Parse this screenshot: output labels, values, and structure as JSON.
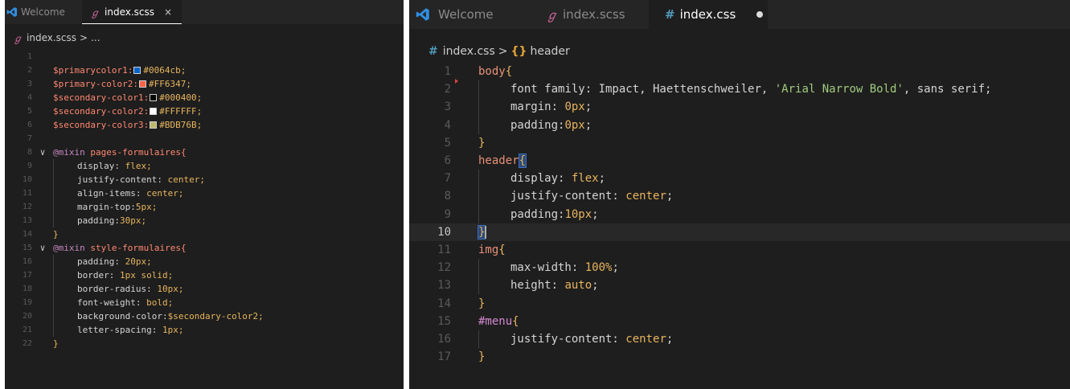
{
  "left_editor": {
    "tabs": [
      {
        "label": "Welcome",
        "icon": "vscode-logo-icon",
        "active": false
      },
      {
        "label": "index.scss",
        "icon": "sass-file-icon",
        "active": true,
        "action": "×"
      }
    ],
    "breadcrumb": {
      "file": "index.scss",
      "sep": ">",
      "rest": "..."
    },
    "lines": [
      {
        "n": "1"
      },
      {
        "n": "2",
        "var": "$primarycolor1:",
        "swatch": "#0064cb",
        "val": "#0064cb;"
      },
      {
        "n": "3",
        "var": "$primary-color2:",
        "swatch": "#FF6347",
        "val": "#FF6347;"
      },
      {
        "n": "4",
        "var": "$secondary-color1:",
        "swatch": "#000400",
        "val": "#000400;"
      },
      {
        "n": "5",
        "var": "$secondary-color2:",
        "swatch": "#FFFFFF",
        "val": "#FFFFFF;"
      },
      {
        "n": "6",
        "var": "$secondary-color3:",
        "swatch": "#BDB76B",
        "val": "#BDB76B;"
      },
      {
        "n": "7"
      },
      {
        "n": "8",
        "fold": "∨",
        "at": "@mixin",
        "name": " pages-formulaires{"
      },
      {
        "n": "9",
        "prop": "display: ",
        "val": "flex;"
      },
      {
        "n": "10",
        "prop": "justify-content: ",
        "val": "center;"
      },
      {
        "n": "11",
        "prop": "align-items: ",
        "val": "center;"
      },
      {
        "n": "12",
        "prop": "margin-top:",
        "val": "5px;"
      },
      {
        "n": "13",
        "prop": "padding:",
        "val": "30px;"
      },
      {
        "n": "14",
        "close": "}"
      },
      {
        "n": "15",
        "fold": "∨",
        "at": "@mixin",
        "name": " style-formulaires{"
      },
      {
        "n": "16",
        "prop": "padding: ",
        "val": "20px;"
      },
      {
        "n": "17",
        "prop": "border: ",
        "val": "1px solid;"
      },
      {
        "n": "18",
        "prop": "border-radius: ",
        "val": "10px;"
      },
      {
        "n": "19",
        "prop": "font-weight: ",
        "val": "bold;"
      },
      {
        "n": "20",
        "prop": "background-color:",
        "val": "$secondary-color2;"
      },
      {
        "n": "21",
        "prop": "letter-spacing: ",
        "val": "1px;"
      },
      {
        "n": "22",
        "close": "}"
      }
    ]
  },
  "right_editor": {
    "tabs": [
      {
        "label": "Welcome",
        "icon": "vscode-logo-icon",
        "active": false
      },
      {
        "label": "index.scss",
        "icon": "sass-file-icon",
        "active": false
      },
      {
        "label": "index.css",
        "icon": "css-file-icon",
        "active": true
      }
    ],
    "breadcrumb": {
      "file": "index.css",
      "sep": ">",
      "symbol": "header"
    },
    "lines": {
      "l1": {
        "n": "1",
        "sel": "body",
        "punc": "{"
      },
      "l2": {
        "n": "2",
        "prop": "font family: ",
        "str1": "Impact, Haettenschweiler, ",
        "str2": "'Arial Narrow Bold'",
        "str3": ", sans serif;"
      },
      "l3": {
        "n": "3",
        "prop": "margin: ",
        "val": "0px",
        "end": ";"
      },
      "l4": {
        "n": "4",
        "prop": "padding:",
        "val": "0px",
        "end": ";"
      },
      "l5": {
        "n": "5",
        "close": "}"
      },
      "l6": {
        "n": "6",
        "sel": "header",
        "punc": "{"
      },
      "l7": {
        "n": "7",
        "prop": "display: ",
        "val": "flex",
        "end": ";"
      },
      "l8": {
        "n": "8",
        "prop": "justify-content: ",
        "val": "center",
        "end": ";"
      },
      "l9": {
        "n": "9",
        "prop": "padding:",
        "val": "10px",
        "end": ";"
      },
      "l10": {
        "n": "10",
        "close": "}"
      },
      "l11": {
        "n": "11",
        "sel": "img",
        "punc": "{"
      },
      "l12": {
        "n": "12",
        "prop": "max-width: ",
        "val": "100%",
        "end": ";"
      },
      "l13": {
        "n": "13",
        "prop": "height: ",
        "val": "auto",
        "end": ";"
      },
      "l14": {
        "n": "14",
        "close": "}"
      },
      "l15": {
        "n": "15",
        "sel": "#menu",
        "punc": "{"
      },
      "l16": {
        "n": "16",
        "prop": "justify-content: ",
        "val": "center",
        "end": ";"
      },
      "l17": {
        "n": "17",
        "close": "}"
      }
    }
  }
}
